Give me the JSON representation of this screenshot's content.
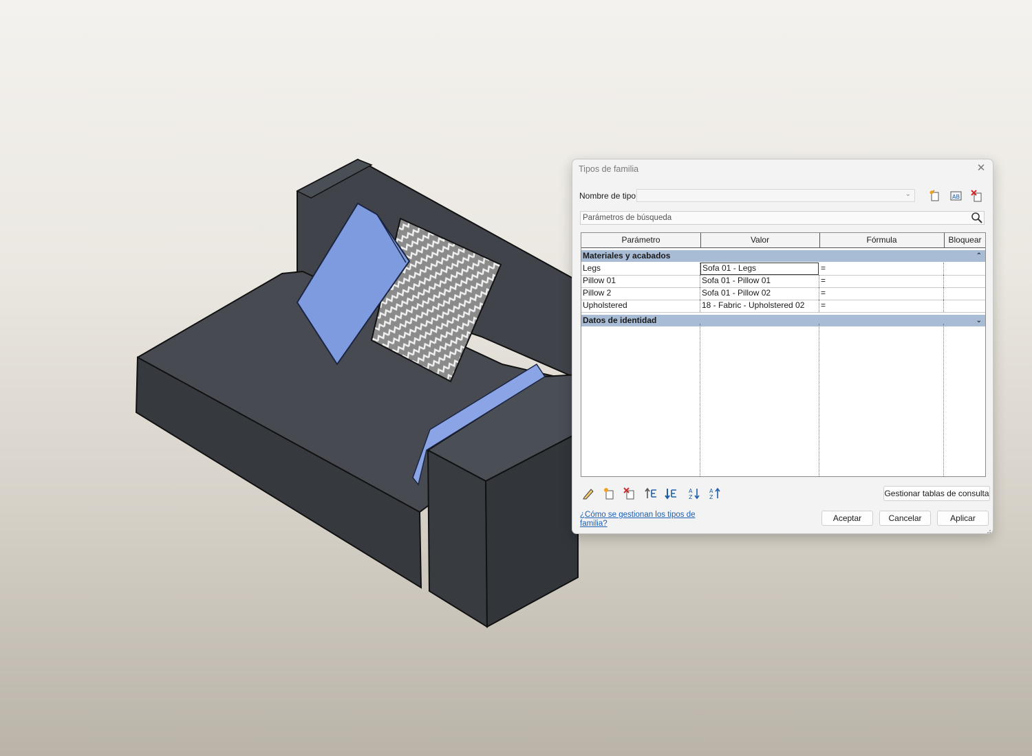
{
  "dialog": {
    "title": "Tipos de familia",
    "type_name_label": "Nombre de tipo:",
    "type_name_value": "",
    "search_placeholder": "Parámetros de búsqueda",
    "columns": [
      "Parámetro",
      "Valor",
      "Fórmula",
      "Bloquear"
    ],
    "groups": [
      {
        "label": "Materiales y acabados",
        "state": "expanded"
      },
      {
        "label": "Datos de identidad",
        "state": "collapsed"
      }
    ],
    "rows": [
      {
        "parameter": "Legs",
        "value": "Sofa 01 - Legs",
        "formula": "="
      },
      {
        "parameter": "Pillow 01",
        "value": "Sofa 01 - Pillow 01",
        "formula": "="
      },
      {
        "parameter": "Pillow 2",
        "value": "Sofa 01 - Pillow 02",
        "formula": "="
      },
      {
        "parameter": "Upholstered",
        "value": "18 - Fabric - Upholstered 02",
        "formula": "="
      }
    ],
    "manage_lookup_label": "Gestionar tablas de consulta",
    "help_link": "¿Cómo se gestionan los tipos de familia?",
    "ok_label": "Aceptar",
    "cancel_label": "Cancelar",
    "apply_label": "Aplicar"
  },
  "icons": {
    "toolbar_top": [
      "new-type-icon",
      "rename-type-icon",
      "delete-type-icon"
    ],
    "toolbar_bottom": [
      "edit-parameter-icon",
      "new-parameter-icon",
      "delete-parameter-icon",
      "move-up-icon",
      "move-down-icon",
      "sort-ascending-icon",
      "sort-descending-icon"
    ]
  },
  "colors": {
    "group_header": "#a8bcd6",
    "sofa_fabric": "#3b3f44",
    "pillow_blue": "#7f9be0",
    "link": "#1a5fb4"
  }
}
